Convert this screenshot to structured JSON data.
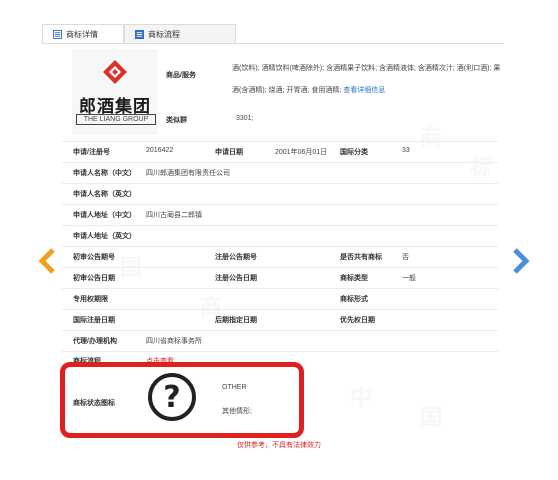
{
  "tabs": [
    {
      "label": "商标详情",
      "active": true
    },
    {
      "label": "商标流程",
      "active": false
    }
  ],
  "logo": {
    "cn": "郎酒集团",
    "en": "THE LIANG GROUP"
  },
  "goods": {
    "label": "商品/服务",
    "text": "酒(饮料); 酒精饮料(啤酒除外); 含酒精果子饮料; 含酒精液体; 含酒精次汁; 酒(利口酒); 果酒(含酒精); 烧酒; 开胃酒; 食用酒精;",
    "more_link": "查看详细信息"
  },
  "similar_group": {
    "label": "类似群",
    "value": "3301;"
  },
  "rows": {
    "reg_no_label": "申请/注册号",
    "reg_no": "2016422",
    "app_date_label": "申请日期",
    "app_date": "2001年06月01日",
    "intl_class_label": "国际分类",
    "intl_class": "33",
    "applicant_cn_label": "申请人名称（中文）",
    "applicant_cn": "四川郎酒集团有限责任公司",
    "applicant_en_label": "申请人名称（英文）",
    "applicant_en": "",
    "address_cn_label": "申请人地址（中文）",
    "address_cn": "四川古蔺县二郎镇",
    "address_en_label": "申请人地址（英文）",
    "address_en": "",
    "prelim_no_label": "初审公告期号",
    "prelim_no": "",
    "reg_pub_no_label": "注册公告期号",
    "reg_pub_no": "",
    "shared_label": "是否共有商标",
    "shared": "否",
    "prelim_date_label": "初审公告日期",
    "prelim_date": "",
    "reg_pub_date_label": "注册公告日期",
    "reg_pub_date": "",
    "mark_type_label": "商标类型",
    "mark_type": "一般",
    "exclusive_label": "专用权期限",
    "exclusive": "",
    "mark_form_label": "商标形式",
    "mark_form": "",
    "intl_reg_date_label": "国际注册日期",
    "intl_reg_date": "",
    "late_date_label": "后期指定日期",
    "late_date": "",
    "priority_date_label": "优先权日期",
    "priority_date": "",
    "agency_label": "代理/办理机构",
    "agency": "四川省商标事务所",
    "process_label": "商标流程",
    "process_link": "点击查看"
  },
  "status": {
    "label": "商标状态图标",
    "code": "OTHER",
    "desc": "其他情形;"
  },
  "disclaimer": "仅供参考，不具有法律效力",
  "colors": {
    "highlight": "#e02020",
    "arrow": "#f0a020",
    "arrow_right": "#4a90d9",
    "link": "#2f6fc7"
  }
}
